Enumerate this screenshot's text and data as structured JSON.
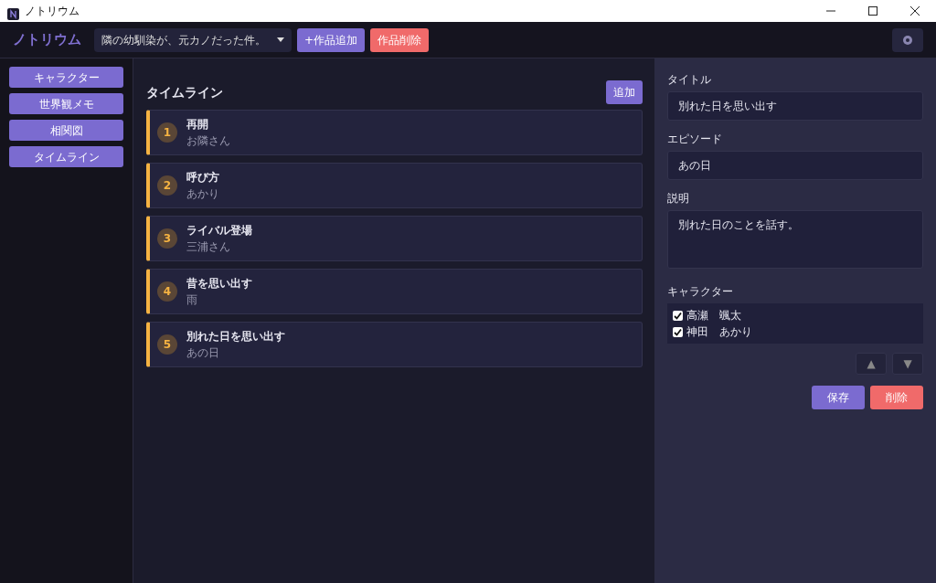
{
  "window": {
    "title": "ノトリウム"
  },
  "header": {
    "logo": "ノトリウム",
    "work_select": {
      "value": "隣の幼馴染が、元カノだった件。"
    },
    "buttons": [
      {
        "label": "+作品追加",
        "kind": "primary"
      },
      {
        "label": "作品削除",
        "kind": "danger"
      }
    ]
  },
  "sidebar": {
    "items": [
      {
        "label": "キャラクター"
      },
      {
        "label": "世界観メモ"
      },
      {
        "label": "相関図"
      },
      {
        "label": "タイムライン"
      }
    ]
  },
  "timeline": {
    "title": "タイムライン",
    "add_button": "追加",
    "events": [
      {
        "number": "1",
        "title": "再開",
        "subtitle": "お隣さん"
      },
      {
        "number": "2",
        "title": "呼び方",
        "subtitle": "あかり"
      },
      {
        "number": "3",
        "title": "ライバル登場",
        "subtitle": "三浦さん"
      },
      {
        "number": "4",
        "title": "昔を思い出す",
        "subtitle": "雨"
      },
      {
        "number": "5",
        "title": "別れた日を思い出す",
        "subtitle": "あの日"
      }
    ]
  },
  "editor": {
    "title_label": "タイトル",
    "title_value": "別れた日を思い出す",
    "episode_label": "エピソード",
    "episode_value": "あの日",
    "description_label": "説明",
    "description_value": "別れた日のことを話す。",
    "characters_label": "キャラクター",
    "characters": [
      {
        "name": "高瀬　颯太",
        "checked": true
      },
      {
        "name": "神田　あかり",
        "checked": true
      }
    ],
    "move_up": "▲",
    "move_down": "▼",
    "save_button": "保存",
    "delete_button": "削除"
  }
}
